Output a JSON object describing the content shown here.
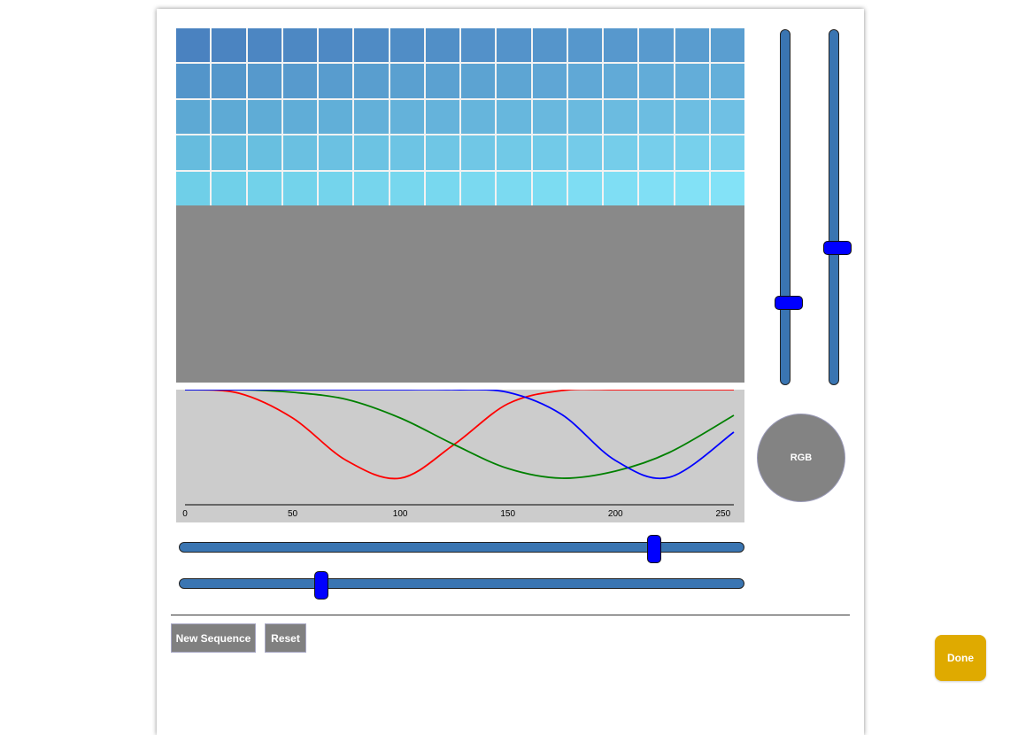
{
  "colors": {
    "grid_top_left": "#4a82c0",
    "grid_top_right": "#5a9ed0",
    "grid_bottom_left": "#6fcfe8",
    "grid_bottom_right": "#83e2f7",
    "preview": "#898989",
    "plot_background": "#cccccc",
    "slider_track": "#3a75b2",
    "slider_thumb": "#0000ff",
    "rgb_circle": "#838383",
    "button_gray": "#808080",
    "done_button": "#dfaa00"
  },
  "color_grid": {
    "columns": 16,
    "rows": 5
  },
  "chart_data": {
    "type": "line",
    "x_range": [
      0,
      255
    ],
    "y_range": [
      0,
      1
    ],
    "x_ticks": [
      "0",
      "50",
      "100",
      "150",
      "200",
      "250"
    ],
    "series": [
      {
        "color": "#ff0000",
        "x": [
          0,
          25,
          50,
          75,
          100,
          125,
          150,
          175,
          200,
          225,
          255
        ],
        "y": [
          0.0,
          0.04,
          0.32,
          0.8,
          1.0,
          0.62,
          0.16,
          0.01,
          0.0,
          0.0,
          0.0
        ]
      },
      {
        "color": "#008000",
        "x": [
          0,
          25,
          50,
          75,
          100,
          125,
          150,
          175,
          200,
          225,
          255
        ],
        "y": [
          0.0,
          0.0,
          0.03,
          0.11,
          0.32,
          0.62,
          0.89,
          1.0,
          0.92,
          0.71,
          0.29
        ]
      },
      {
        "color": "#0000ff",
        "x": [
          0,
          25,
          50,
          75,
          100,
          125,
          150,
          175,
          200,
          225,
          255
        ],
        "y": [
          0.0,
          0.0,
          0.0,
          0.0,
          0.0,
          0.0,
          0.03,
          0.28,
          0.8,
          0.99,
          0.48
        ]
      }
    ]
  },
  "sliders": {
    "vertical_1_value": 0.78,
    "vertical_2_value": 0.62,
    "horizontal_1_value": 0.85,
    "horizontal_2_value": 0.245
  },
  "rgb_circle_label": "RGB",
  "buttons": {
    "new_sequence": "New Sequence",
    "reset": "Reset",
    "done": "Done"
  }
}
